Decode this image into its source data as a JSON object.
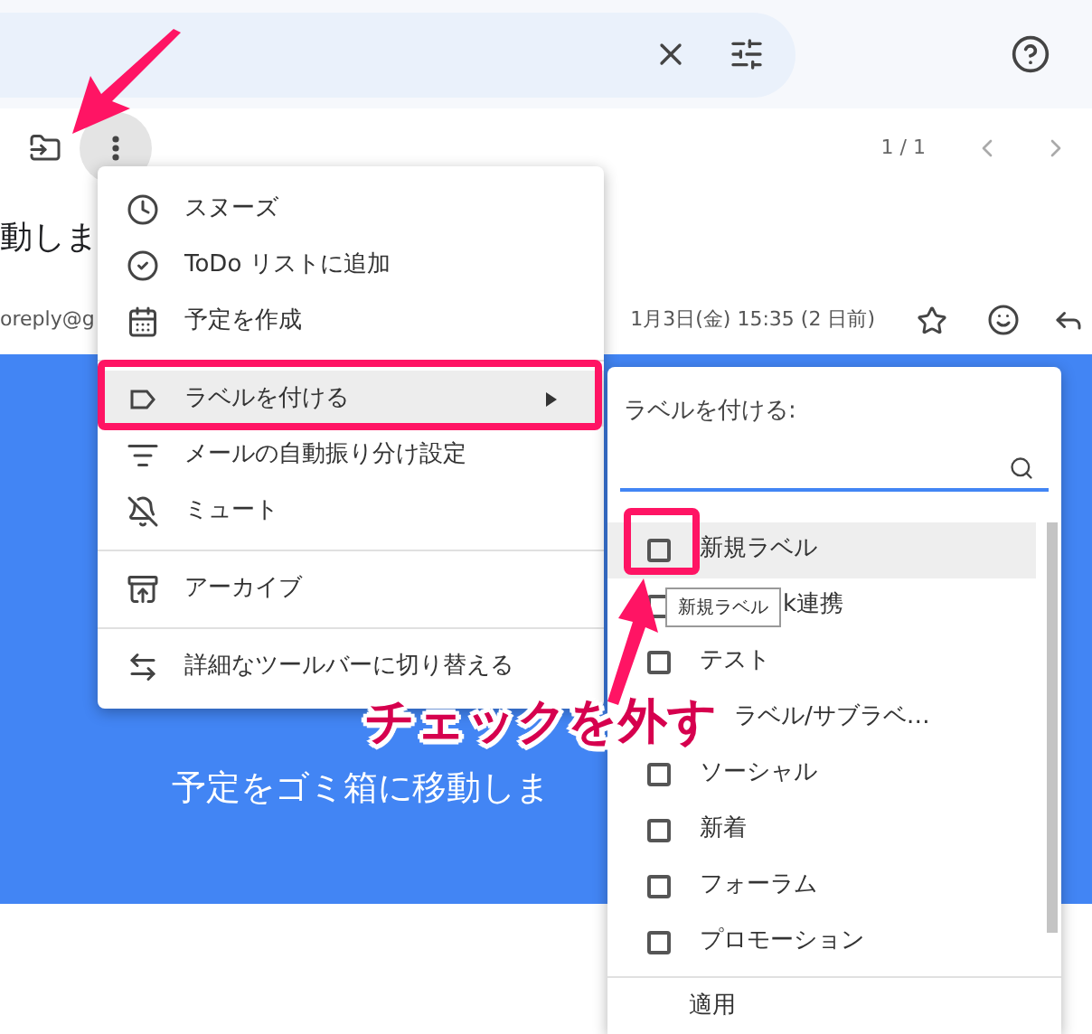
{
  "toolbar": {
    "page_count": "1 / 1"
  },
  "subject": "動しま",
  "sender": {
    "address": "oreply@g",
    "date": "1月3日(金) 15:35 (2 日前)"
  },
  "banner": {
    "text": "予定をゴミ箱に移動しま"
  },
  "menu": {
    "items": [
      {
        "kind": "item",
        "label": "スヌーズ",
        "selected": false
      },
      {
        "kind": "item",
        "label": "ToDo リストに追加",
        "selected": false
      },
      {
        "kind": "item",
        "label": "予定を作成",
        "selected": false
      },
      {
        "kind": "divider"
      },
      {
        "kind": "submenu",
        "label": "ラベルを付ける",
        "selected": true
      },
      {
        "kind": "item",
        "label": "メールの自動振り分け設定",
        "selected": false
      },
      {
        "kind": "item",
        "label": "ミュート",
        "selected": false
      },
      {
        "kind": "divider"
      },
      {
        "kind": "item",
        "label": "アーカイブ",
        "selected": false
      },
      {
        "kind": "divider"
      },
      {
        "kind": "item",
        "label": "詳細なツールバーに切り替える",
        "selected": false
      }
    ]
  },
  "label_panel": {
    "title": "ラベルを付ける:",
    "labels": [
      {
        "kind": "full",
        "name": "新規ラベル",
        "checked": false,
        "selected": true
      },
      {
        "kind": "tail-tooltip",
        "name": "k連携",
        "checked": false,
        "selected": false
      },
      {
        "kind": "full",
        "name": "テスト",
        "checked": false,
        "selected": false
      },
      {
        "kind": "tail-callout",
        "name": "ラベル/サブラベ…",
        "selected": false
      },
      {
        "kind": "full",
        "name": "ソーシャル",
        "checked": false,
        "selected": false
      },
      {
        "kind": "full",
        "name": "新着",
        "checked": false,
        "selected": false
      },
      {
        "kind": "full",
        "name": "フォーラム",
        "checked": false,
        "selected": false
      },
      {
        "kind": "full",
        "name": "プロモーション",
        "checked": false,
        "selected": false
      }
    ],
    "apply": "適用"
  },
  "tooltip": "新規ラベル",
  "annotation": {
    "callout": "チェックを外す"
  }
}
